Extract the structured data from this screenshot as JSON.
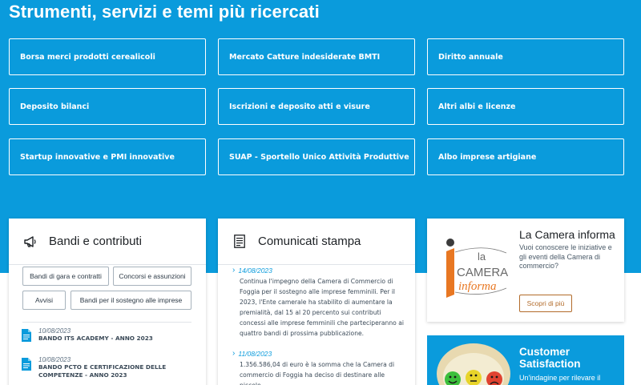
{
  "section_title": "Strumenti, servizi e temi più ricercati",
  "tools": [
    "Borsa merci prodotti cerealicoli",
    "Mercato Catture indesiderate BMTI",
    "Diritto annuale",
    "Deposito bilanci",
    "Iscrizioni e deposito atti e visure",
    "Altri albi e licenze",
    "Startup innovative e PMI innovative",
    "SUAP - Sportello Unico Attività Produttive",
    "Albo imprese artigiane"
  ],
  "bandi": {
    "title": "Bandi e contributi",
    "icon": "megaphone-icon",
    "chips": [
      "Bandi di gara e contratti",
      "Concorsi e assunzioni",
      "Avvisi",
      "Bandi per il sostegno alle imprese"
    ],
    "docs": [
      {
        "date": "10/08/2023",
        "title": "BANDO ITS ACADEMY - ANNO 2023"
      },
      {
        "date": "10/08/2023",
        "title": "BANDO PCTO E CERTIFICAZIONE DELLE COMPETENZE - ANNO 2023"
      }
    ]
  },
  "comunicati": {
    "title": "Comunicati stampa",
    "icon": "newspaper-icon",
    "items": [
      {
        "date": "14/08/2023",
        "text": "Continua l'impegno della Camera di Commercio di Foggia per il sostegno alle imprese femminili. Per il 2023, l'Ente camerale ha stabilito di aumentare la premialità, dal 15 al 20 percento sui contributi concessi alle imprese femminili che parteciperanno ai quattro bandi di prossima pubblicazione."
      },
      {
        "date": "11/08/2023",
        "text": "1.356.586,04 di euro è la somma che la Camera di commercio di Foggia ha deciso di destinare alle piccole"
      }
    ]
  },
  "camera_informa": {
    "logo_line1": "la",
    "logo_line2": "CAMERA",
    "logo_line3": "informa",
    "title": "La Camera informa",
    "description": "Vuoi conoscere le iniziative e gli eventi della Camera di commercio?",
    "button": "Scopri di più"
  },
  "customer": {
    "title_line1": "Customer",
    "title_line2": "Satisfaction",
    "description": "Un'indagine per rilevare il"
  },
  "colors": {
    "brand_blue": "#0a9bdc",
    "accent_orange": "#e87722",
    "button_brown": "#b26b2a"
  }
}
